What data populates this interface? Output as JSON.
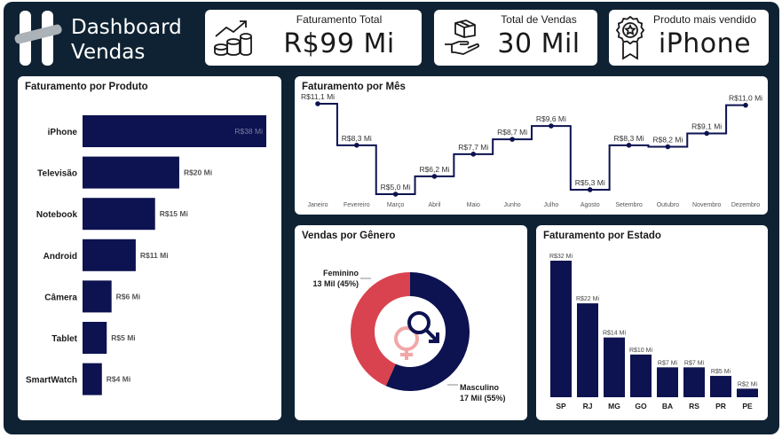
{
  "header": {
    "logo_line1": "Dashboard",
    "logo_line2": "Vendas",
    "kpis": [
      {
        "title": "Faturamento Total",
        "value": "R$99 Mi",
        "icon": "coins-growth-icon"
      },
      {
        "title": "Total de Vendas",
        "value": "30 Mil",
        "icon": "box-hand-icon"
      },
      {
        "title": "Produto mais vendido",
        "value": "iPhone",
        "icon": "award-ribbon-icon"
      }
    ]
  },
  "colors": {
    "navy": "#0d1250",
    "red": "#d9434f",
    "frame": "#0f2233",
    "gender_icon_pink": "#f2a7a7"
  },
  "chart_data": [
    {
      "id": "produto",
      "type": "bar",
      "orientation": "horizontal",
      "title": "Faturamento por Produto",
      "categories": [
        "iPhone",
        "Televisão",
        "Notebook",
        "Android",
        "Câmera",
        "Tablet",
        "SmartWatch"
      ],
      "values": [
        38,
        20,
        15,
        11,
        6,
        5,
        4
      ],
      "labels": [
        "R$38 Mi",
        "R$20 Mi",
        "R$15 Mi",
        "R$11 Mi",
        "R$6 Mi",
        "R$5 Mi",
        "R$4 Mi"
      ],
      "unit": "R$ Mi"
    },
    {
      "id": "mes",
      "type": "line",
      "step": true,
      "title": "Faturamento por Mês",
      "categories": [
        "Janeiro",
        "Fevereiro",
        "Março",
        "Abril",
        "Maio",
        "Junho",
        "Julho",
        "Agosto",
        "Setembro",
        "Outubro",
        "Novembro",
        "Dezembro"
      ],
      "values": [
        11.1,
        8.3,
        5.0,
        6.2,
        7.7,
        8.7,
        9.6,
        5.3,
        8.3,
        8.2,
        9.1,
        11.0
      ],
      "labels": [
        "R$11,1 Mi",
        "R$8,3 Mi",
        "R$5,0 Mi",
        "R$6,2 Mi",
        "R$7,7 Mi",
        "R$8,7 Mi",
        "R$9,6 Mi",
        "R$5,3 Mi",
        "R$8,3 Mi",
        "R$8,2 Mi",
        "R$9,1 Mi",
        "R$11,0 Mi"
      ],
      "unit": "R$ Mi"
    },
    {
      "id": "genero",
      "type": "pie",
      "donut": true,
      "title": "Vendas por Gênero",
      "slices": [
        {
          "name": "Masculino",
          "value": 17,
          "label": "17 Mil (55%)",
          "percent": 55
        },
        {
          "name": "Feminino",
          "value": 13,
          "label": "13 Mil (45%)",
          "percent": 45
        }
      ]
    },
    {
      "id": "estado",
      "type": "bar",
      "orientation": "vertical",
      "title": "Faturamento por Estado",
      "categories": [
        "SP",
        "RJ",
        "MG",
        "GO",
        "BA",
        "RS",
        "PR",
        "PE"
      ],
      "values": [
        32,
        22,
        14,
        10,
        7,
        7,
        5,
        2
      ],
      "labels": [
        "R$32 Mi",
        "R$22 Mi",
        "R$14 Mi",
        "R$10 Mi",
        "R$7 Mi",
        "R$7 Mi",
        "R$5 Mi",
        "R$2 Mi"
      ],
      "unit": "R$ Mi"
    }
  ]
}
